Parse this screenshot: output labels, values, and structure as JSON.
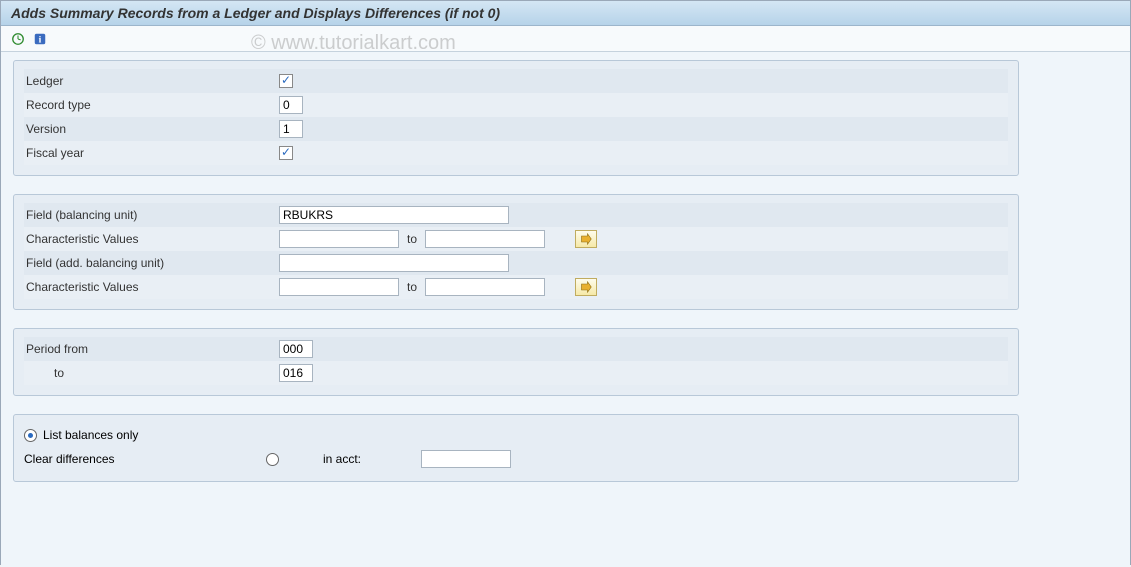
{
  "title": "Adds Summary Records from a Ledger and Displays Differences (if not 0)",
  "watermark": "© www.tutorialkart.com",
  "group1": {
    "ledger_label": "Ledger",
    "ledger_checked": true,
    "record_type_label": "Record type",
    "record_type_value": "0",
    "version_label": "Version",
    "version_value": "1",
    "fiscal_year_label": "Fiscal year",
    "fiscal_year_checked": true
  },
  "group2": {
    "field_bu_label": "Field (balancing unit)",
    "field_bu_value": "RBUKRS",
    "char_values_label": "Characteristic Values",
    "char_values1_from": "",
    "char_values1_to": "",
    "to_label": "to",
    "field_addbu_label": "Field (add. balancing unit)",
    "field_addbu_value": "",
    "char_values2_from": "",
    "char_values2_to": ""
  },
  "group3": {
    "period_from_label": "Period from",
    "period_from_value": "000",
    "period_to_label": "to",
    "period_to_value": "016"
  },
  "group4": {
    "list_balances_label": "List balances only",
    "list_balances_selected": true,
    "clear_diff_label": "Clear differences",
    "clear_diff_selected": false,
    "in_acct_label": "in acct:",
    "in_acct_value": ""
  }
}
